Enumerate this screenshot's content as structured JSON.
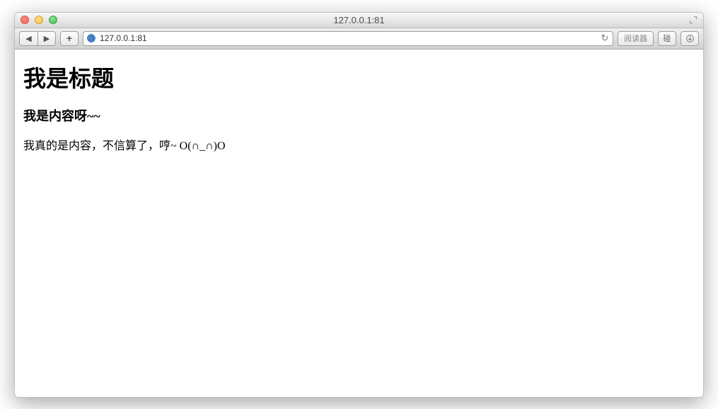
{
  "window": {
    "title": "127.0.0.1:81"
  },
  "toolbar": {
    "url": "127.0.0.1:81",
    "reader_label": "阅读器",
    "share_label": "碰"
  },
  "page": {
    "heading": "我是标题",
    "subheading": "我是内容呀~~",
    "body": "我真的是内容，不信算了，哼~ O(∩_∩)O"
  }
}
